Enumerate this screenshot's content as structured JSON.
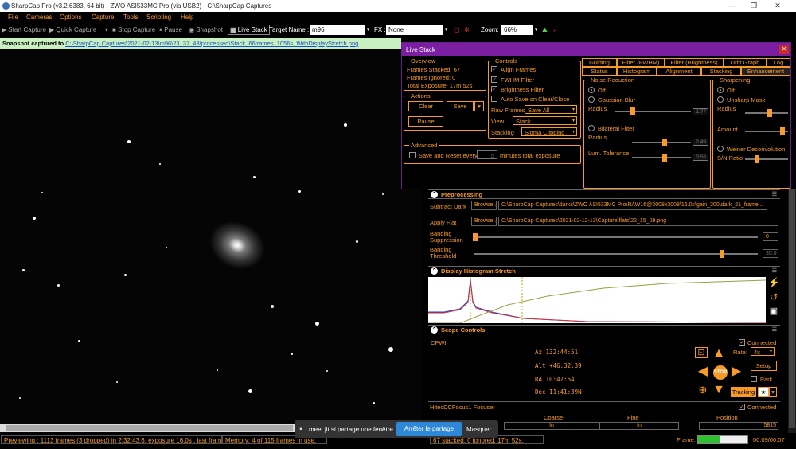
{
  "window": {
    "title": "SharpCap Pro (v3.2.6383, 64 bit) - ZWO ASI533MC Pro (via USB2) - C:\\SharpCap Captures"
  },
  "menu": [
    "File",
    "Cameras",
    "Options",
    "Capture",
    "Tools",
    "Scripting",
    "Help"
  ],
  "toolbar": {
    "start_capture": "Start Capture",
    "quick_capture": "Quick Capture",
    "stop_capture": "Stop Capture",
    "pause": "Pause",
    "snapshot": "Snapshot",
    "live_stack": "Live Stack",
    "target_name_label": "Target Name :",
    "target_name_value": "m96",
    "fx_label": "FX :",
    "fx_value": "None",
    "zoom_label": "Zoom:",
    "zoom_value": "66%"
  },
  "snapshot_bar": {
    "prefix": "Snapshot captured to",
    "path": "C:\\SharpCap Captures\\2021-02-13\\m96\\23_37_43\\processed\\Stack_66frames_1056s_WithDisplayStretch.png"
  },
  "live_stack": {
    "title": "Live Stack",
    "overview": {
      "label": "Overview",
      "frames_stacked": "Frames Stacked: 67",
      "frames_ignored": "Frames Ignored:  0",
      "total_exposure": "Total Exposure:   17m 52s"
    },
    "actions": {
      "label": "Actions",
      "clear": "Clear",
      "save": "Save",
      "pause": "Pause"
    },
    "advanced": {
      "label": "Advanced",
      "save_reset": "Save and Reset every",
      "minutes_value": "5",
      "minutes_suffix": "minutes total exposure"
    },
    "controls": {
      "label": "Controls",
      "align_frames": "Align Frames",
      "fwhm_filter": "FWHM Filter",
      "brightness_filter": "Brightness Filter",
      "auto_save": "Auto Save on Clear/Close",
      "raw_frames_label": "Raw Frames",
      "raw_frames_value": "Save All",
      "view_label": "View",
      "view_value": "Stack",
      "stacking_label": "Stacking",
      "stacking_value": "Sigma Clipping"
    },
    "tabs_row1": [
      "Guiding",
      "Filter (FWHM)",
      "Filter (Brightness)",
      "Drift Graph",
      "Log"
    ],
    "tabs_row2": [
      "Status",
      "Histogram",
      "Alignment",
      "Stacking",
      "Enhancement"
    ],
    "noise_reduction": {
      "label": "Noise Reduction",
      "off": "Off",
      "gaussian": "Gaussian Blur",
      "radius": "Radius",
      "radius_value": "1.77",
      "bilateral": "Bilateral Filter",
      "radius2": "Radius",
      "radius2_value": "2.49",
      "lum_tol": "Lum. Tolerance",
      "lum_tol_value": "0.56"
    },
    "sharpening": {
      "label": "Sharpening",
      "off": "Off",
      "unsharp": "Unsharp Mask",
      "radius": "Radius",
      "amount": "Amount",
      "weiner": "Weiner Deconvolution",
      "sn_ratio": "S/N Ratio"
    }
  },
  "preprocessing": {
    "title": "Preprocessing",
    "subtract_dark": "Subtract Dark",
    "browse": "Browse...",
    "dark_path": "C:\\SharpCap Captures\\darks\\ZWO ASI533MC Pro\\RAW16@3008x3008\\16.0s\\gain_200\\dark_21_frame...",
    "apply_flat": "Apply Flat",
    "flat_path": "C:\\SharpCap Captures\\2021-02-12-13\\Capture\\flats\\22_15_09.png",
    "banding_suppression": "Banding Suppression",
    "banding_suppression_value": "0",
    "banding_threshold": "Banding Threshold",
    "banding_threshold_value": "35.0"
  },
  "histogram_stretch": {
    "title": "Display Histogram Stretch"
  },
  "scope": {
    "title": "Scope Controls",
    "connected": "Connected",
    "driver": "CPWI",
    "az": "Az   132:44:51",
    "alt": "Alt  +46:32:39",
    "ra": "RA   10:47:54",
    "dec": "Dec  11:41:39N",
    "rate_label": "Rate:",
    "rate_value": "4x",
    "setup": "Setup",
    "park": "Park",
    "stop": "STOP",
    "tracking": "Tracking"
  },
  "focuser": {
    "name": "HitecDCFocus1 Focuser",
    "connected": "Connected",
    "coarse": "Coarse",
    "fine": "Fine",
    "position": "Position",
    "in": "In",
    "in2": "In",
    "position_value": "5815"
  },
  "share_toast": {
    "text": "meet.jit.si partage une fenêtre.",
    "stop": "Arrêter le partage",
    "hide": "Masquer"
  },
  "status": {
    "previewing": "Previewing : 1113 frames (3 dropped) in 2:32:43,6, exposure 16,0s , last frame 16,0",
    "memory": "Memory: 4 of 115 frames in use.",
    "stack_info": "67 stacked, 0 ignored, 17m 52s.",
    "frame_label": "Frame:",
    "frame_time": "00:09/00:07",
    "frame_progress": 0.45
  }
}
